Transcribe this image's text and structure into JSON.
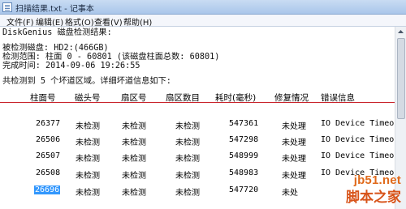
{
  "window": {
    "title": "扫描结果.txt - 记事本"
  },
  "menu": [
    "文件(F)",
    "编辑(E)",
    "格式(O)",
    "查看(V)",
    "帮助(H)"
  ],
  "document": {
    "lines": [
      "DiskGenius 磁盘检测结果:",
      "被检测磁盘: HD2:(466GB)",
      "检测范围: 柱面 0 - 60801 (该磁盘柱面总数: 60801)",
      "完成时间: 2014-09-06 19:26:55",
      "共检测到 5 个坏道区域。详细坏道信息如下:"
    ],
    "table": {
      "headers": [
        "柱面号",
        "磁头号",
        "扇区号",
        "扇区数目",
        "耗时(毫秒)",
        "修复情况",
        "错误信息"
      ],
      "rows": [
        [
          "26377",
          "未检测",
          "未检测",
          "未检测",
          "547361",
          "未处理",
          "IO Device Timeout."
        ],
        [
          "26506",
          "未检测",
          "未检测",
          "未检测",
          "547298",
          "未处理",
          "IO Device Timeout."
        ],
        [
          "26507",
          "未检测",
          "未检测",
          "未检测",
          "548999",
          "未处理",
          "IO Device Timeout."
        ],
        [
          "26508",
          "未检测",
          "未检测",
          "未检测",
          "548983",
          "未处理",
          "IO Device Timeo"
        ],
        [
          "26696",
          "未检测",
          "未检测",
          "未检测",
          "547720",
          "未处",
          ""
        ]
      ],
      "selected_cell": "26696"
    }
  },
  "watermark": {
    "site": "jb51.net",
    "name": "脚本之家"
  }
}
